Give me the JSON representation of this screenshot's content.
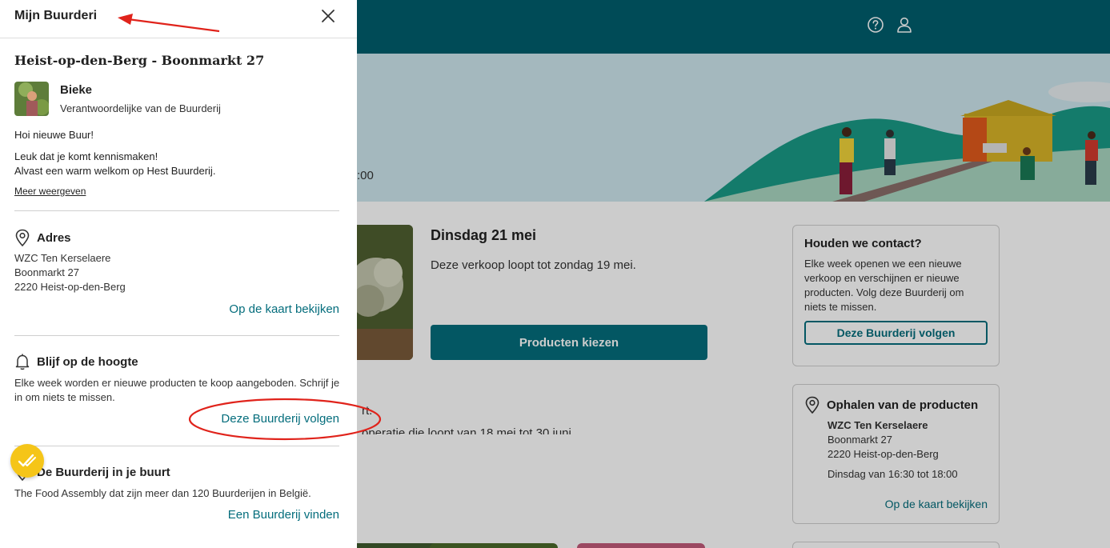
{
  "panel": {
    "title": "Mijn Buurderi",
    "farm_name": "Heist-op-den-Berg - Boonmarkt 27",
    "host": {
      "name": "Bieke",
      "role": "Verantwoordelijke van de Buurderij"
    },
    "greeting": "Hoi nieuwe Buur!",
    "message_line1": "Leuk dat je komt kennismaken!",
    "message_line2": "Alvast een warm welkom op Hest Buurderij.",
    "more_link": "Meer weergeven",
    "address": {
      "title": "Adres",
      "line1": "WZC Ten Kerselaere",
      "line2": "Boonmarkt 27",
      "line3": "2220 Heist-op-den-Berg",
      "map_link": "Op de kaart bekijken"
    },
    "updates": {
      "title": "Blijf op de hoogte",
      "text": "Elke week worden er nieuwe producten te koop aangeboden. Schrijf je in om niets te missen.",
      "follow_link": "Deze Buurderij volgen"
    },
    "nearby": {
      "title": "De Buurderij in je buurt",
      "text": "The Food Assembly dat zijn meer dan 120 Buurderijen in België.",
      "find_link": "Een Buurderij vinden"
    }
  },
  "background": {
    "hero_time": ":00",
    "sale": {
      "title": "Dinsdag 21 mei",
      "subtitle": "Deze verkoop loopt tot zondag 19 mei.",
      "button": "Producten kiezen"
    },
    "fragment1": "rt.",
    "fragment2": "operatie die loopt van 18 mei tot 30 juni",
    "contact_card": {
      "title": "Houden we contact?",
      "text": "Elke week openen we een nieuwe verkoop en verschijnen er nieuwe producten. Volg deze Buurderij om niets te missen.",
      "button": "Deze Buurderij volgen"
    },
    "pickup_card": {
      "title": "Ophalen van de producten",
      "place": "WZC Ten Kerselaere",
      "street": "Boonmarkt 27",
      "city": "2220 Heist-op-den-Berg",
      "hours": "Dinsdag van 16:30 tot 18:00",
      "map_link": "Op de kaart bekijken"
    }
  },
  "colors": {
    "topbar": "#005e6d",
    "accent": "#046d7c",
    "annotation": "#e0231b",
    "badge": "#f5c518"
  },
  "icons": [
    "close-icon",
    "help-icon",
    "user-icon",
    "location-pin-icon",
    "bell-icon",
    "checkmark-badge-icon"
  ]
}
